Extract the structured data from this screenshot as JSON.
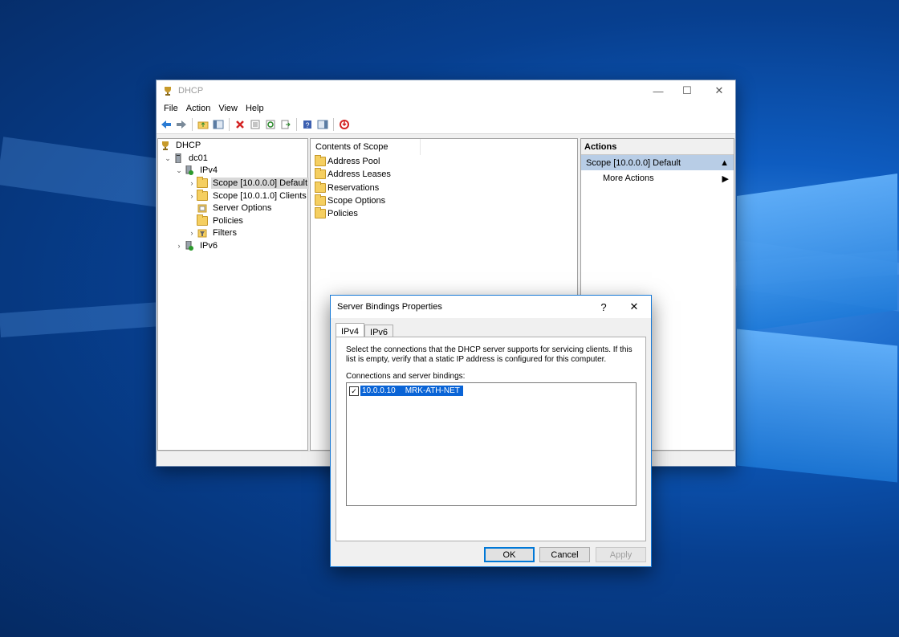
{
  "window": {
    "title": "DHCP",
    "menu": [
      "File",
      "Action",
      "View",
      "Help"
    ],
    "controls": {
      "minimize": "—",
      "maximize": "☐",
      "close": "✕"
    }
  },
  "toolbar_icons": [
    "back-arrow-icon",
    "forward-arrow-icon",
    "up-folder-icon",
    "show-hide-tree-icon",
    "delete-icon",
    "properties-icon",
    "refresh-icon",
    "export-list-icon",
    "help-icon",
    "show-action-pane-icon",
    "shutdown-icon"
  ],
  "tree": {
    "root": "DHCP",
    "server": "dc01",
    "ipv4": "IPv4",
    "scope1": "Scope [10.0.0.0] Default",
    "scope2": "Scope [10.0.1.0] Clients",
    "server_options": "Server Options",
    "policies": "Policies",
    "filters": "Filters",
    "ipv6": "IPv6"
  },
  "content": {
    "header": "Contents of Scope",
    "items": [
      "Address Pool",
      "Address Leases",
      "Reservations",
      "Scope Options",
      "Policies"
    ]
  },
  "actions": {
    "header": "Actions",
    "group": "Scope [10.0.0.0] Default",
    "more": "More Actions"
  },
  "dialog": {
    "title": "Server Bindings Properties",
    "help": "?",
    "close": "✕",
    "tabs": [
      "IPv4",
      "IPv6"
    ],
    "description": "Select the connections that the DHCP server supports for servicing clients. If this list is empty, verify that a static IP address is configured for this computer.",
    "connections_label": "Connections and server bindings:",
    "bindings": [
      {
        "checked": true,
        "ip": "10.0.0.10",
        "name": "MRK-ATH-NET"
      }
    ],
    "buttons": {
      "ok": "OK",
      "cancel": "Cancel",
      "apply": "Apply"
    }
  },
  "colors": {
    "accent": "#0078d7",
    "selection": "#0a64d6",
    "action_group": "#b8cde6"
  }
}
